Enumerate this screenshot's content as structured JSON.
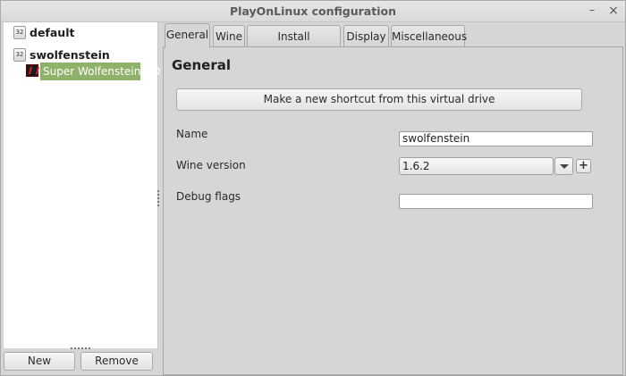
{
  "window": {
    "title": "PlayOnLinux configuration",
    "minimize_glyph": "–",
    "close_glyph": "×"
  },
  "tree": {
    "items": [
      {
        "badge": "32",
        "label": "default"
      },
      {
        "badge": "32",
        "label": "swolfenstein",
        "children": [
          {
            "label": "Super Wolfenstein HD",
            "icon": "wolfenstein-game-icon",
            "selected": true
          }
        ]
      }
    ]
  },
  "left_buttons": {
    "new": "New",
    "remove": "Remove"
  },
  "tabs": [
    {
      "label": "General",
      "active": true
    },
    {
      "label": "Wine",
      "active": false
    },
    {
      "label": "Install components",
      "active": false
    },
    {
      "label": "Display",
      "active": false
    },
    {
      "label": "Miscellaneous",
      "active": false
    }
  ],
  "general": {
    "heading": "General",
    "shortcut_button": "Make a new shortcut from this virtual drive",
    "name_label": "Name",
    "name_value": "swolfenstein",
    "wine_version_label": "Wine version",
    "wine_version_value": "1.6.2",
    "plus_glyph": "+",
    "debug_flags_label": "Debug flags",
    "debug_flags_value": ""
  },
  "colors": {
    "selection": "#8fb26a"
  }
}
